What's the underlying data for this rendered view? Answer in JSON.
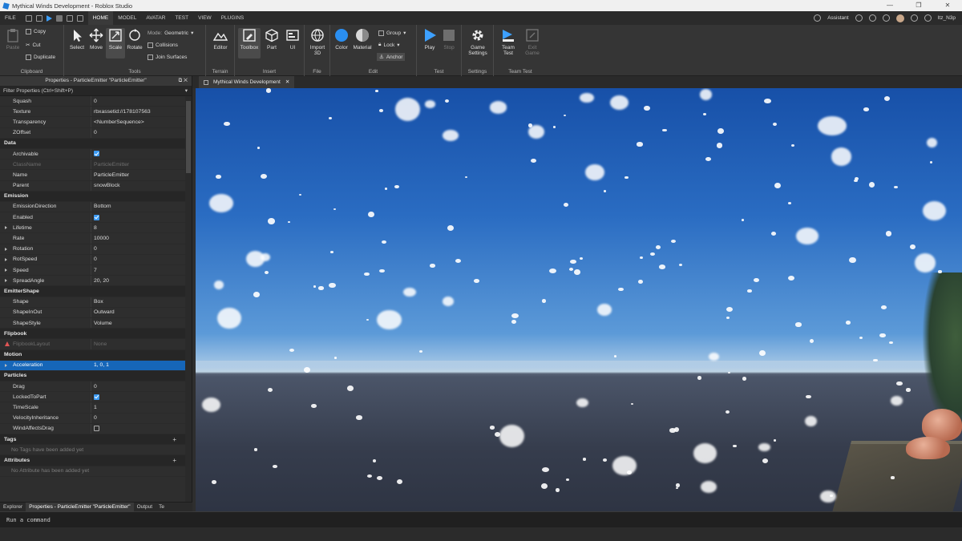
{
  "window": {
    "title": "Mythical Winds Development - Roblox Studio",
    "controls": [
      "—",
      "❐",
      "✕"
    ]
  },
  "menubar": {
    "file_label": "FILE",
    "tabs": [
      "HOME",
      "MODEL",
      "AVATAR",
      "TEST",
      "VIEW",
      "PLUGINS"
    ],
    "active_tab": "HOME",
    "assistant_label": "Assistant",
    "username": "Itz_N3p"
  },
  "ribbon": {
    "clipboard": {
      "paste": "Paste",
      "copy": "Copy",
      "cut": "Cut",
      "duplicate": "Duplicate",
      "label": "Clipboard"
    },
    "tools": {
      "select": "Select",
      "move": "Move",
      "scale": "Scale",
      "rotate": "Rotate",
      "mode_label": "Mode:",
      "mode_value": "Geometric",
      "collisions": "Collisions",
      "join_surfaces": "Join Surfaces",
      "label": "Tools"
    },
    "terrain": {
      "editor": "Editor",
      "label": "Terrain"
    },
    "insert": {
      "toolbox": "Toolbox",
      "part": "Part",
      "ui": "UI",
      "label": "Insert"
    },
    "file": {
      "import3d": "Import 3D",
      "label": "File"
    },
    "edit": {
      "color": "Color",
      "material": "Material",
      "group": "Group",
      "lock": "Lock",
      "anchor": "Anchor",
      "label": "Edit"
    },
    "test": {
      "play": "Play",
      "stop": "Stop",
      "label": "Test"
    },
    "settings": {
      "game_settings": "Game Settings",
      "label": "Settings"
    },
    "team_test": {
      "team_test": "Team Test",
      "exit_game": "Exit Game",
      "label": "Team Test"
    }
  },
  "properties": {
    "header": "Properties - ParticleEmitter \"ParticleEmitter\"",
    "filter_placeholder": "Filter Properties (Ctrl+Shift+P)",
    "rows": [
      {
        "type": "prop",
        "key": "Squash",
        "value": "0"
      },
      {
        "type": "prop",
        "key": "Texture",
        "value": "rbxassetid://178107563"
      },
      {
        "type": "prop",
        "key": "Transparency",
        "value": "<NumberSequence>"
      },
      {
        "type": "prop",
        "key": "ZOffset",
        "value": "0"
      },
      {
        "type": "cat",
        "key": "Data"
      },
      {
        "type": "check",
        "key": "Archivable",
        "checked": true
      },
      {
        "type": "prop",
        "key": "ClassName",
        "value": "ParticleEmitter",
        "disabled": true
      },
      {
        "type": "prop",
        "key": "Name",
        "value": "ParticleEmitter"
      },
      {
        "type": "prop",
        "key": "Parent",
        "value": "snowBlock"
      },
      {
        "type": "cat",
        "key": "Emission"
      },
      {
        "type": "prop",
        "key": "EmissionDirection",
        "value": "Bottom"
      },
      {
        "type": "check",
        "key": "Enabled",
        "checked": true
      },
      {
        "type": "prop",
        "key": "Lifetime",
        "value": "8",
        "expand": true
      },
      {
        "type": "prop",
        "key": "Rate",
        "value": "10000"
      },
      {
        "type": "prop",
        "key": "Rotation",
        "value": "0",
        "expand": true
      },
      {
        "type": "prop",
        "key": "RotSpeed",
        "value": "0",
        "expand": true
      },
      {
        "type": "prop",
        "key": "Speed",
        "value": "7",
        "expand": true
      },
      {
        "type": "prop",
        "key": "SpreadAngle",
        "value": "20, 20",
        "expand": true
      },
      {
        "type": "cat",
        "key": "EmitterShape"
      },
      {
        "type": "prop",
        "key": "Shape",
        "value": "Box"
      },
      {
        "type": "prop",
        "key": "ShapeInOut",
        "value": "Outward"
      },
      {
        "type": "prop",
        "key": "ShapeStyle",
        "value": "Volume"
      },
      {
        "type": "cat",
        "key": "Flipbook"
      },
      {
        "type": "prop",
        "key": "FlipbookLayout",
        "value": "None",
        "disabled": true,
        "warning": true
      },
      {
        "type": "cat",
        "key": "Motion"
      },
      {
        "type": "prop",
        "key": "Acceleration",
        "value": "1, 0, 1",
        "expand": true,
        "selected": true
      },
      {
        "type": "cat",
        "key": "Particles"
      },
      {
        "type": "prop",
        "key": "Drag",
        "value": "0"
      },
      {
        "type": "check",
        "key": "LockedToPart",
        "checked": true
      },
      {
        "type": "prop",
        "key": "TimeScale",
        "value": "1"
      },
      {
        "type": "prop",
        "key": "VelocityInheritance",
        "value": "0"
      },
      {
        "type": "check",
        "key": "WindAffectsDrag",
        "checked": false
      },
      {
        "type": "cat",
        "key": "Tags",
        "plus": true
      },
      {
        "type": "info",
        "key": "No Tags have been added yet"
      },
      {
        "type": "cat",
        "key": "Attributes",
        "plus": true
      },
      {
        "type": "info",
        "key": "No Attribute has been added yet"
      }
    ]
  },
  "bottom_tabs": [
    "Explorer",
    "Properties - ParticleEmitter \"ParticleEmitter\"",
    "Output",
    "Te"
  ],
  "document_tab": "Mythical Winds Development",
  "command_bar": {
    "placeholder": "Run a command"
  }
}
